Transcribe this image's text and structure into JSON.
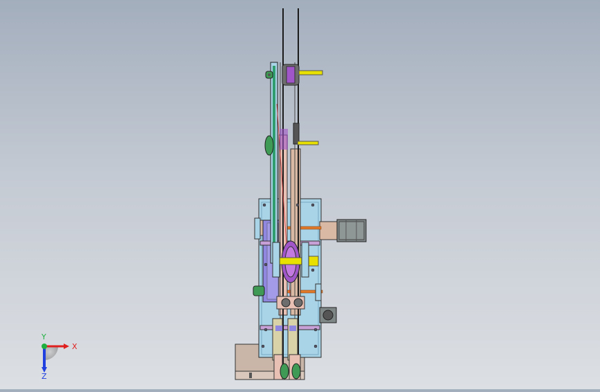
{
  "viewport": {
    "background_top": "#a3aebd",
    "background_bottom": "#dcdfe3"
  },
  "model": {
    "part_colors": {
      "base_plate": "#a9d3e6",
      "slider_beige": "#d9b9a3",
      "arm_pink": "#e8c0b4",
      "motor_gray": "#7f8686",
      "hub_purple": "#a055c8",
      "accent_yellow": "#e8e000",
      "knob_green": "#3f9a55",
      "plate_violet": "#8f87e0",
      "foot_tan": "#c9b6a8"
    }
  },
  "triad": {
    "x_label": "X",
    "y_label": "Y",
    "z_label": "Z",
    "x_color": "#e02020",
    "y_color": "#20b040",
    "z_color": "#2040e0"
  }
}
